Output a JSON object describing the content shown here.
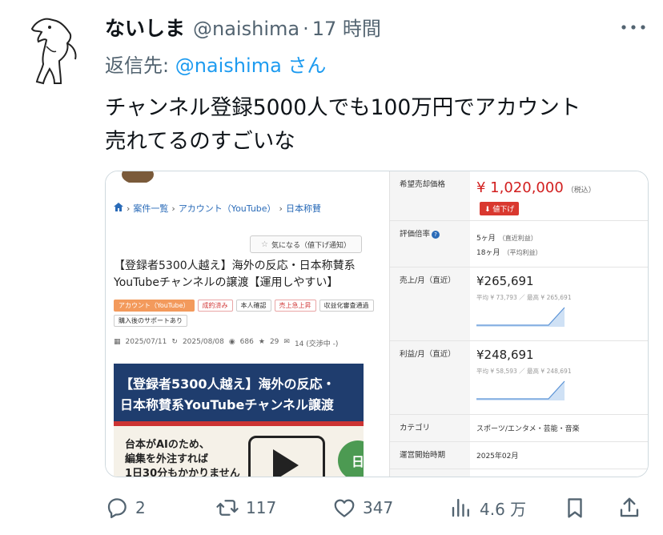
{
  "tweet": {
    "author_name": "ないしま",
    "handle": "@naishima",
    "separator": "·",
    "time": "17 時間",
    "reply_prefix": "返信先: ",
    "reply_mention": "@naishima",
    "reply_suffix": " さん",
    "text_line1": "チャンネル登録5000人でも100万円でアカウント",
    "text_line2": "売れてるのすごいな"
  },
  "listing": {
    "breadcrumb": [
      "案件一覧",
      "アカウント（YouTube）",
      "日本称賛"
    ],
    "favorite_button": "気になる（値下げ通知）",
    "title": "【登録者5300人越え】海外の反応・日本称賛系YouTubeチャンネルの譲渡【運用しやすい】",
    "tags": [
      "アカウント（YouTube）",
      "成約済み",
      "本人確認",
      "売上急上昇",
      "収益化審査通過",
      "購入後のサポートあり"
    ],
    "meta": [
      "2025/07/11",
      "2025/08/08",
      "686",
      "29",
      "14 (交渉中 -)"
    ],
    "banner_line1": "【登録者5300人越え】海外の反応・",
    "banner_line2": "日本称賛系YouTubeチャンネル譲渡",
    "lower_line1": "台本がAIのため、",
    "lower_line2": "編集を外注すれば",
    "lower_line3": "1日30分もかかりません",
    "green_char": "日"
  },
  "table": {
    "price_label": "希望売却価格",
    "price": "¥ 1,020,000",
    "price_tax": "（税込）",
    "price_badge": "値下げ",
    "multiple_label": "評価倍率",
    "multiple_1": "5ヶ月",
    "multiple_1_sub": "（直近利益）",
    "multiple_2": "18ヶ月",
    "multiple_2_sub": "（平均利益）",
    "sales_label": "売上/月（直近）",
    "sales_value": "¥265,691",
    "sales_avgs": "平均 ¥ 73,793 ／ 最高 ¥ 265,691",
    "profit_label": "利益/月（直近）",
    "profit_value": "¥248,691",
    "profit_avgs": "平均 ¥ 58,593 ／ 最高 ¥ 248,691",
    "category_label": "カテゴリ",
    "category_value": "スポーツ/エンタメ・芸能・音楽",
    "start_label": "運営開始時期",
    "start_value": "2025年02月"
  },
  "actions": {
    "replies": "2",
    "retweets": "117",
    "likes": "347",
    "views": "4.6 万"
  },
  "colors": {
    "link": "#1d9bf0",
    "secondary_text": "#536471",
    "price_red": "#d21f1f"
  }
}
